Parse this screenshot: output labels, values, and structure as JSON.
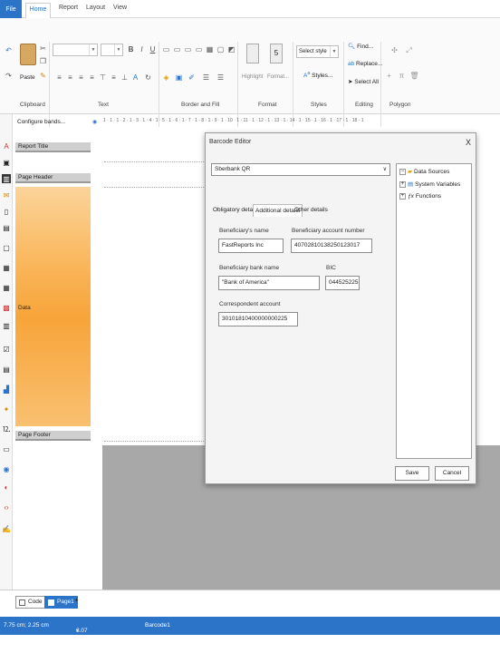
{
  "menubar": {
    "file": "File",
    "home": "Home",
    "report": "Report",
    "layout": "Layout",
    "view": "View"
  },
  "ribbon": {
    "paste": "Paste",
    "groups": {
      "clipboard": "Clipboard",
      "text": "Text",
      "border_fill": "Border and Fill",
      "format": "Format",
      "styles": "Styles",
      "editing": "Editing",
      "polygon": "Polygon"
    },
    "text_b": "B",
    "text_i": "I",
    "text_u": "U",
    "highlight": "Highlight",
    "format_label": "Format...",
    "select_style": "Select style",
    "styles_btn": "Styles...",
    "find": "Find...",
    "replace": "Replace...",
    "select_all": "Select All",
    "format_num": "5"
  },
  "toolbar": {
    "configure_bands": "Configure bands..."
  },
  "bands": {
    "report_title": "Report Title",
    "page_header": "Page Header",
    "data": "Data",
    "page_footer": "Page Footer"
  },
  "ruler": "1 · 1 · 1 · 2 · 1 · 3 · 1 · 4 · 1 · 5 · 1 · 6 · 1 · 7 · 1 · 8 · 1 · 9 · 1 · 10 · 1 · 11 · 1 · 12 · 1 · 13 · 1 · 14 · 1 · 15 · 1 · 16 · 1 · 17 · 1 · 18 · 1",
  "dialog": {
    "title": "Barcode Editor",
    "close": "X",
    "type": "Sberbank QR",
    "tabs": [
      "Obligatory details",
      "Additional details",
      "Other details"
    ],
    "beneficiary_name_label": "Beneficiary's name",
    "beneficiary_name": "FastReports Inc",
    "account_number_label": "Beneficiary account number",
    "account_number": "40702810138250123017",
    "bank_name_label": "Beneficiary bank name",
    "bank_name": "\"Bank of America\"",
    "bic_label": "BIC",
    "bic": "044525225",
    "correspondent_label": "Correspondent account",
    "correspondent": "30101810400000000225",
    "tree": [
      "Data Sources",
      "System Variables",
      "Functions"
    ],
    "save": "Save",
    "cancel": "Cancel"
  },
  "bottom_tabs": {
    "code": "Code",
    "page1": "Page1",
    "add": "+"
  },
  "status": {
    "pos": "7.75 cm; 2.25 cm",
    "size": "3.07 cm; 3.07 cm",
    "name": "Barcode1"
  },
  "colors": {
    "accent": "#2b74c7",
    "band": "#f7a53a"
  }
}
